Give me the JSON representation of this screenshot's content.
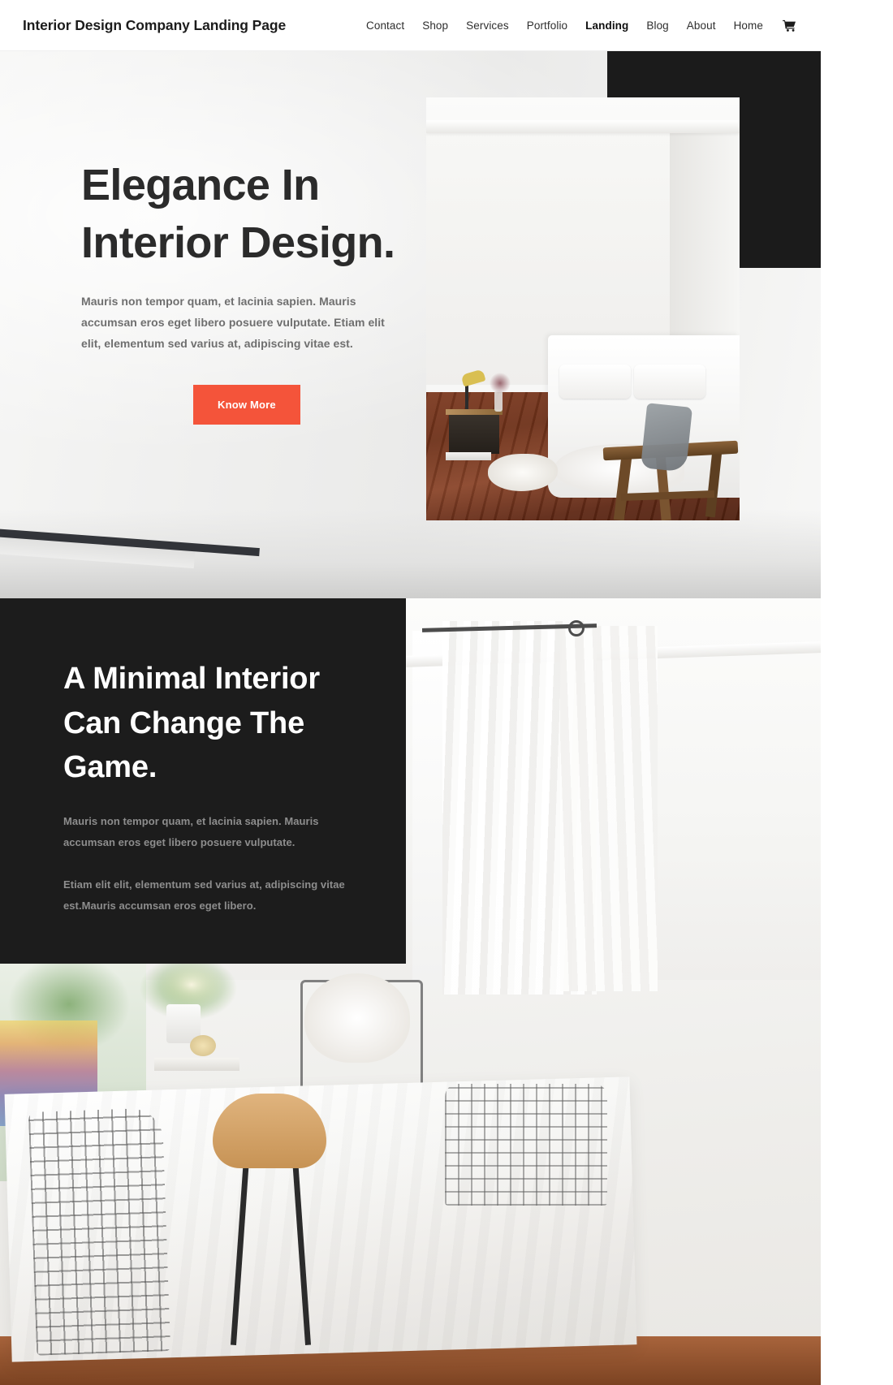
{
  "header": {
    "brand": "Interior Design Company Landing Page",
    "nav": [
      {
        "label": "Contact",
        "active": false
      },
      {
        "label": "Shop",
        "active": false
      },
      {
        "label": "Services",
        "active": false
      },
      {
        "label": "Portfolio",
        "active": false
      },
      {
        "label": "Landing",
        "active": true
      },
      {
        "label": "Blog",
        "active": false
      },
      {
        "label": "About",
        "active": false
      },
      {
        "label": "Home",
        "active": false
      }
    ],
    "cart_icon": "shopping-cart-icon"
  },
  "hero": {
    "title_line1": "Elegance In",
    "title_line2": "Interior Design.",
    "paragraph": "Mauris non tempor quam, et lacinia sapien. Mauris accumsan eros eget libero posuere vulputate. Etiam elit elit, elementum sed varius at, adipiscing vitae est.",
    "cta_label": "Know More",
    "cta_color": "#f4543a",
    "slab_color": "#1b1b1b",
    "photo_alt": "minimal-bedroom-photo"
  },
  "feature": {
    "title_line1": "A Minimal Interior",
    "title_line2": "Can Change The",
    "title_line3": "Game.",
    "paragraph1": "Mauris non tempor quam, et lacinia sapien. Mauris accumsan eros eget libero posuere vulputate.",
    "paragraph2": "Etiam elit elit, elementum sed varius at, adipiscing vitae est.Mauris accumsan eros eget libero.",
    "card_color": "#1c1c1c",
    "photo_alt": "dining-room-photo"
  }
}
